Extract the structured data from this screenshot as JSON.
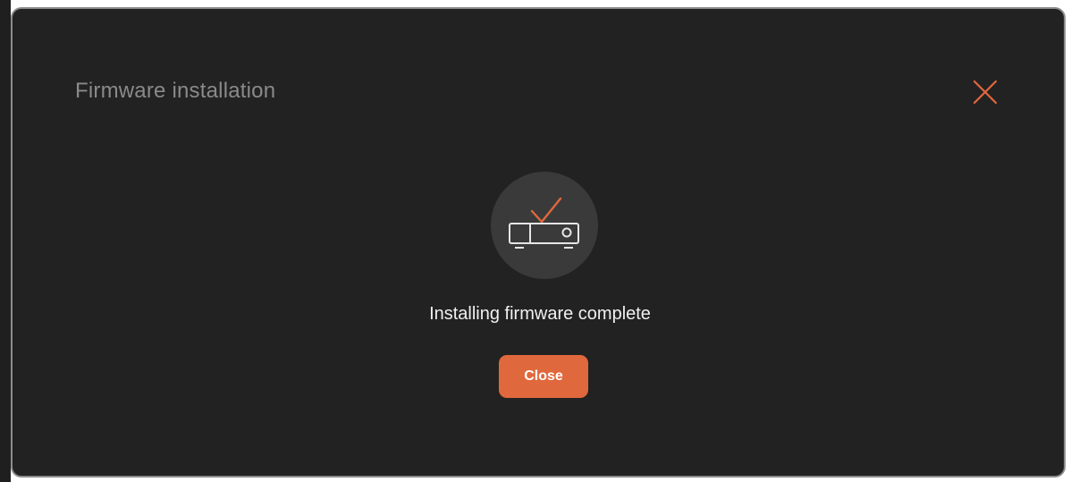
{
  "dialog": {
    "title": "Firmware installation",
    "close_icon": "close-icon",
    "status_icon": "projector-check-icon",
    "message": "Installing firmware complete",
    "close_button_label": "Close"
  },
  "colors": {
    "background": "#222222",
    "accent": "#e0683d",
    "title_text": "#8a8a8a",
    "message_text": "#f0f0f0",
    "icon_circle": "#3a3a3a"
  }
}
